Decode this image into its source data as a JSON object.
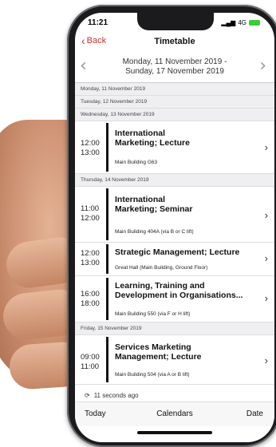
{
  "status": {
    "time": "11:21",
    "network": "4G"
  },
  "nav": {
    "back_label": "Back",
    "title": "Timetable"
  },
  "week_range": {
    "line1": "Monday, 11 November 2019 -",
    "line2": "Sunday, 17 November 2019"
  },
  "days": {
    "mon": "Monday, 11 November 2019",
    "tue": "Tuesday, 12 November 2019",
    "wed": "Wednesday, 13 November 2019",
    "thu": "Thursday, 14 November 2019",
    "fri": "Friday, 15 November 2019"
  },
  "events": [
    {
      "start": "12:00",
      "end": "13:00",
      "title1": "International",
      "title2": "Marketing; Lecture",
      "location": "Main Building G63"
    },
    {
      "start": "11:00",
      "end": "12:00",
      "title1": "International",
      "title2": "Marketing; Seminar",
      "location": "Main Building 404A (via B or C lift)"
    },
    {
      "start": "12:00",
      "end": "13:00",
      "title1": "Strategic Management; Lecture",
      "title2": "",
      "location": "Great Hall (Main Building, Ground Floor)"
    },
    {
      "start": "16:00",
      "end": "18:00",
      "title1": "Learning, Training and",
      "title2": "Development in Organisations...",
      "location": "Main Building 550 (via F or H lift)"
    },
    {
      "start": "09:00",
      "end": "11:00",
      "title1": "Services Marketing",
      "title2": "Management; Lecture",
      "location": "Main Building 504 (via A or B lift)"
    }
  ],
  "refresh_text": "11 seconds ago",
  "toolbar": {
    "today": "Today",
    "calendars": "Calendars",
    "date": "Date"
  },
  "colors": {
    "accent": "#d0312d"
  }
}
